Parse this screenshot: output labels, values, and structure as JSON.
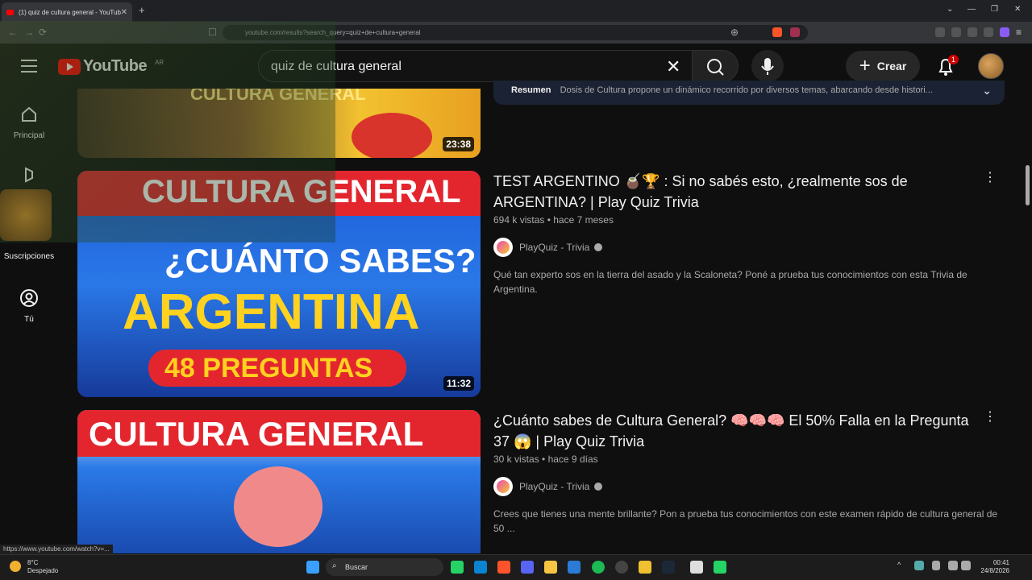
{
  "browser": {
    "tab_title": "(1) quiz de cultura general - YouTube",
    "url": "youtube.com/results?search_query=quiz+de+cultura+general",
    "status_url": "https://www.youtube.com/watch?v=..."
  },
  "header": {
    "logo_text": "YouTube",
    "country_code": "AR",
    "search_value": "quiz de cultura general",
    "create_label": "Crear",
    "notif_count": "1"
  },
  "sidebar": {
    "items": [
      {
        "label": "Principal"
      },
      {
        "label": "Shorts"
      },
      {
        "label": "Suscripciones"
      },
      {
        "label": "Tú"
      }
    ]
  },
  "results": [
    {
      "duration": "23:38",
      "thumb_text": "CULTURA GENERAL",
      "summary_label": "Resumen",
      "summary_text": "Dosis de Cultura propone un dinámico recorrido por diversos temas, abarcando desde histori..."
    },
    {
      "title": "TEST ARGENTINO 🧉🏆 : Si no sabés esto, ¿realmente sos de ARGENTINA? | Play Quiz Trivia",
      "views": "694 k vistas",
      "age": "hace 7 meses",
      "channel": "PlayQuiz - Trivia",
      "description": "Qué tan experto sos en la tierra del asado y la Scaloneta? Poné a prueba tus conocimientos con esta Trivia de Argentina.",
      "duration": "11:32",
      "thumb_line1": "CULTURA GENERAL",
      "thumb_line2": "¿CUÁNTO SABES?",
      "thumb_line3": "ARGENTINA",
      "thumb_line4": "48 PREGUNTAS"
    },
    {
      "title": "¿Cuánto sabes de Cultura General? 🧠🧠🧠 El 50% Falla en la Pregunta 37 😱 | Play Quiz Trivia",
      "views": "30 k vistas",
      "age": "hace 9 días",
      "channel": "PlayQuiz - Trivia",
      "description": "Crees que tienes una mente brillante? Pon a prueba tus conocimientos con este examen rápido de cultura general de 50 ...",
      "thumb_line1": "CULTURA GENERAL"
    }
  ],
  "taskbar": {
    "temp": "8°C",
    "weather": "Despejado",
    "search_label": "Buscar",
    "time": "00:41",
    "date": "24/8/2026"
  },
  "colors": {
    "accent": "#ff0000",
    "background": "#0f0f0f"
  }
}
